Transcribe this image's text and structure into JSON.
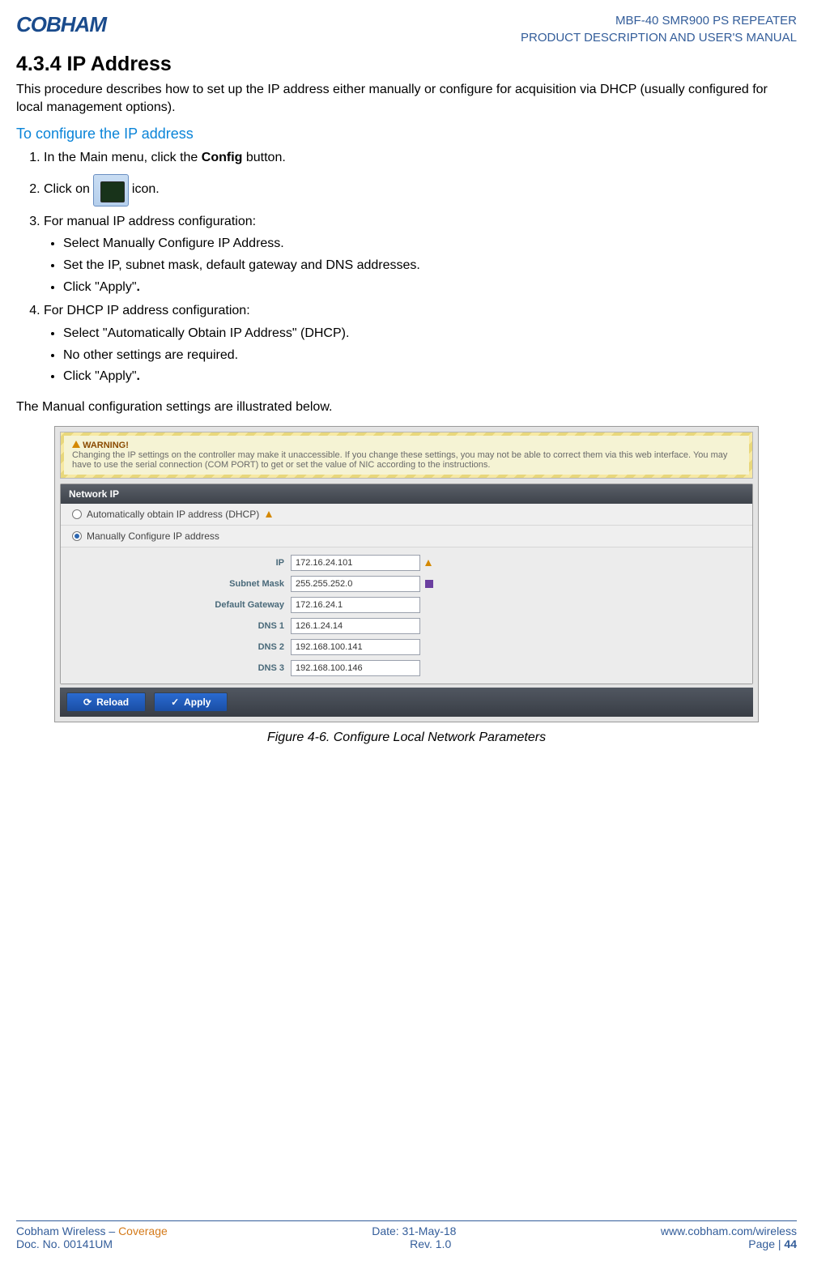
{
  "header": {
    "logo_text": "COBHAM",
    "doc_line1": "MBF-40 SMR900 PS REPEATER",
    "doc_line2": "PRODUCT DESCRIPTION AND USER'S MANUAL"
  },
  "section": {
    "number_title": "4.3.4 IP Address",
    "intro": "This procedure describes how to set up the IP address either manually or configure for acquisition via DHCP (usually configured for local management options).",
    "sub_heading": "To configure the IP address",
    "steps": {
      "s1_pre": "In the Main menu, click the ",
      "s1_bold": "Config",
      "s1_post": " button.",
      "s2_pre": "Click on ",
      "s2_post": " icon.",
      "s3": "For manual IP address configuration:",
      "s3_bullets": {
        "b1": "Select Manually Configure IP Address.",
        "b2": "Set the IP, subnet mask, default gateway and DNS addresses.",
        "b3_pre": "Click \"Apply\"",
        "b3_bold": "."
      },
      "s4": "For DHCP IP address configuration:",
      "s4_bullets": {
        "b1": "Select \"Automatically Obtain IP Address\" (DHCP).",
        "b2": "No other settings are required.",
        "b3_pre": "Click \"Apply\"",
        "b3_bold": "."
      }
    },
    "shown_below": "The Manual configuration settings are illustrated below."
  },
  "screenshot": {
    "warning_title": "WARNING!",
    "warning_text": "Changing the IP settings on the controller may make it unaccessible. If you change these settings, you may not be able to correct them via this web interface. You may have to use the serial connection (COM PORT) to get or set the value of NIC according to the instructions.",
    "panel_title": "Network IP",
    "radio_dhcp": "Automatically obtain IP address (DHCP)",
    "radio_manual": "Manually Configure IP address",
    "fields": {
      "ip_label": "IP",
      "ip_value": "172.16.24.101",
      "subnet_label": "Subnet Mask",
      "subnet_value": "255.255.252.0",
      "gateway_label": "Default Gateway",
      "gateway_value": "172.16.24.1",
      "dns1_label": "DNS 1",
      "dns1_value": "126.1.24.14",
      "dns2_label": "DNS 2",
      "dns2_value": "192.168.100.141",
      "dns3_label": "DNS 3",
      "dns3_value": "192.168.100.146"
    },
    "reload_btn": "Reload",
    "apply_btn": "Apply"
  },
  "figure_caption": "Figure 4-6.  Configure Local Network Parameters",
  "footer": {
    "left1_a": "Cobham Wireless",
    "left1_sep": " – ",
    "left1_b": "Coverage",
    "left2": "Doc. No. 00141UM",
    "mid1": "Date: 31-May-18",
    "mid2": "Rev. 1.0",
    "right1": "www.cobham.com/wireless",
    "right2_pre": "Page | ",
    "right2_num": "44"
  }
}
